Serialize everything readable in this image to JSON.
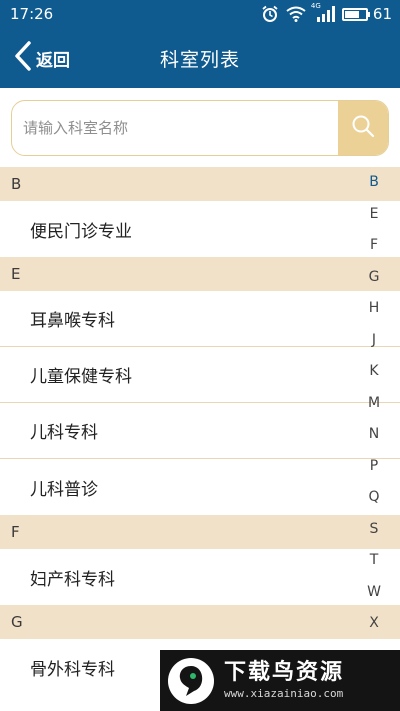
{
  "status_bar": {
    "time": "17:26",
    "network_label": "4G",
    "battery_level": "61",
    "icons": [
      "alarm-icon",
      "wifi-icon",
      "signal-icon",
      "battery-icon"
    ]
  },
  "nav": {
    "back_label": "返回",
    "title": "科室列表"
  },
  "search": {
    "placeholder": "请输入科室名称",
    "value": "",
    "icon": "search-icon"
  },
  "sections": [
    {
      "letter": "B",
      "items": [
        "便民门诊专业"
      ]
    },
    {
      "letter": "E",
      "items": [
        "耳鼻喉专科",
        "儿童保健专科",
        "儿科专科",
        "儿科普诊"
      ]
    },
    {
      "letter": "F",
      "items": [
        "妇产科专科"
      ]
    },
    {
      "letter": "G",
      "items": [
        "骨外科专科"
      ]
    }
  ],
  "index_letters": [
    "B",
    "E",
    "F",
    "G",
    "H",
    "J",
    "K",
    "M",
    "N",
    "P",
    "Q",
    "S",
    "T",
    "W",
    "X"
  ],
  "watermark": {
    "title": "下载鸟资源",
    "url": "www.xiazainiao.com"
  },
  "colors": {
    "primary": "#0f5a8f",
    "section_bg": "#f2e1c9",
    "accent": "#ecd197",
    "divider": "#e8d7b5"
  }
}
